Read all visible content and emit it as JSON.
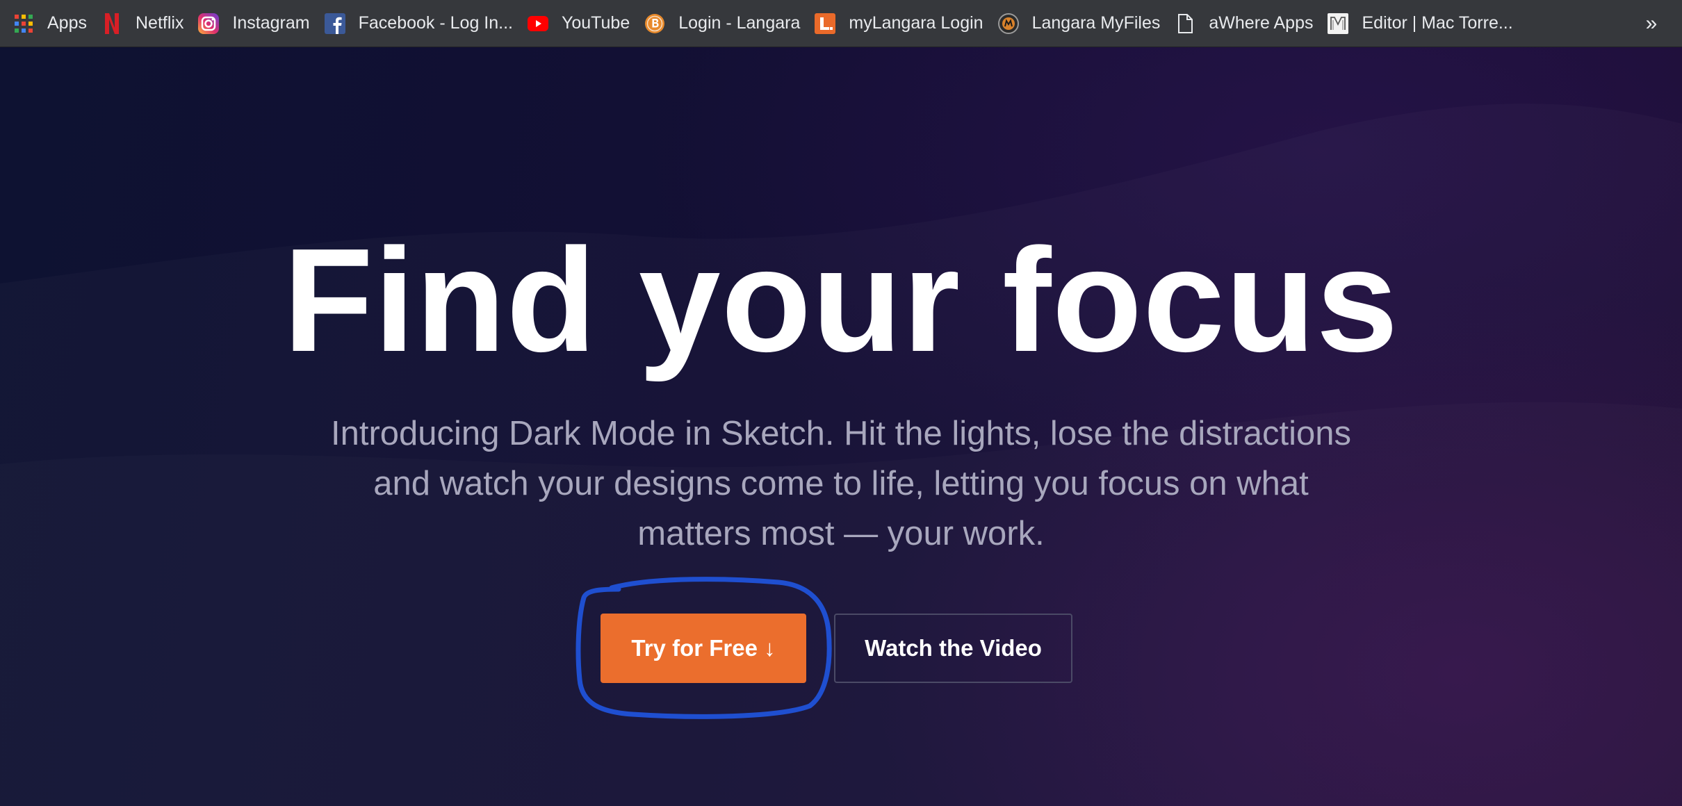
{
  "bookmarks": {
    "items": [
      {
        "label": "Apps",
        "icon": "apps-grid-icon"
      },
      {
        "label": "Netflix",
        "icon": "netflix-icon"
      },
      {
        "label": "Instagram",
        "icon": "instagram-icon"
      },
      {
        "label": "Facebook - Log In...",
        "icon": "facebook-icon"
      },
      {
        "label": "YouTube",
        "icon": "youtube-icon"
      },
      {
        "label": "Login - Langara",
        "icon": "langara-coin-icon"
      },
      {
        "label": "myLangara Login",
        "icon": "langara-l-icon"
      },
      {
        "label": "Langara MyFiles",
        "icon": "myfiles-icon"
      },
      {
        "label": "aWhere Apps",
        "icon": "document-icon"
      },
      {
        "label": "Editor | Mac Torre...",
        "icon": "editor-m-icon"
      }
    ],
    "overflow_label": "»"
  },
  "hero": {
    "headline": "Find your focus",
    "subheadline": "Introducing Dark Mode in Sketch. Hit the lights, lose the distractions and watch your designs come to life, letting you focus on what matters most — your work.",
    "primary_button": "Try for Free ↓",
    "secondary_button": "Watch the Video"
  },
  "colors": {
    "background": "#110d2a",
    "primary_button": "#eb6e2d",
    "annotation_stroke": "#1f4fd0",
    "subheadline_text": "#a8a7bd"
  }
}
